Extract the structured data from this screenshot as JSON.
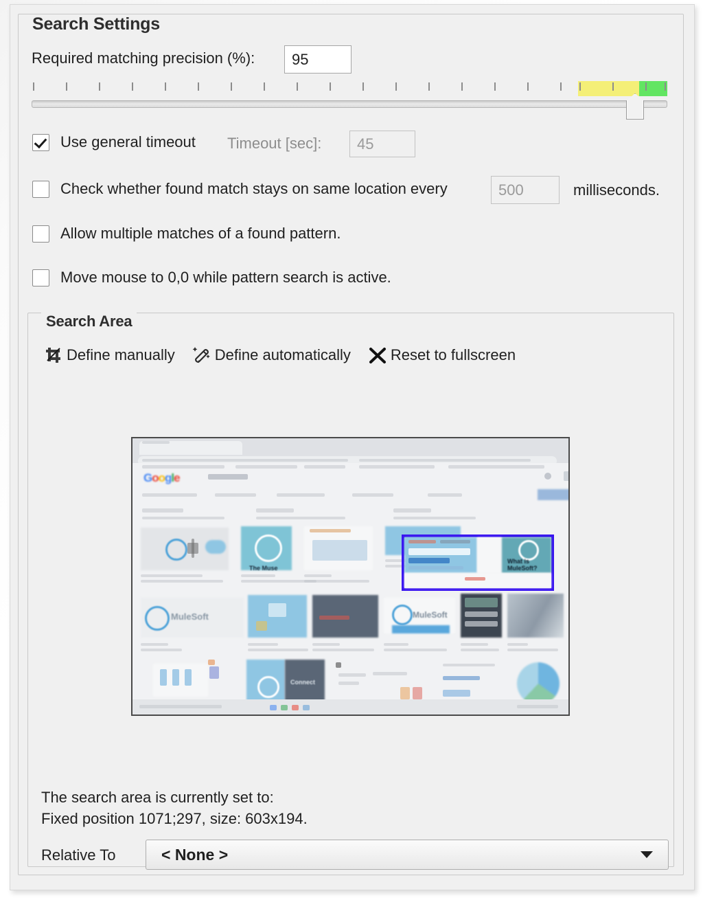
{
  "settings_group": {
    "title": "Search Settings",
    "precision": {
      "label": "Required matching precision (%):",
      "value": "95"
    },
    "slider": {
      "tick_count": 20,
      "thumb_percent": 95,
      "yellow_band": {
        "start_percent": 86,
        "end_percent": 96,
        "color": "#f4ef77"
      },
      "green_band": {
        "start_percent": 96,
        "end_percent": 100,
        "color": "#62e562"
      }
    },
    "checkboxes": [
      {
        "name": "use-general-timeout",
        "label": "Use general timeout",
        "checked": true
      },
      {
        "name": "check-same-location",
        "label": "Check whether found match stays on same location every",
        "checked": false
      },
      {
        "name": "allow-multiple-matches",
        "label": "Allow multiple matches of a found pattern.",
        "checked": false
      },
      {
        "name": "move-mouse-origin",
        "label": "Move mouse to 0,0 while pattern search is active.",
        "checked": false
      }
    ],
    "timeout": {
      "label": "Timeout [sec]:",
      "value": "45",
      "disabled": true
    },
    "interval": {
      "value": "500",
      "suffix": "milliseconds.",
      "disabled": true
    }
  },
  "search_area": {
    "title": "Search Area",
    "toolbar": [
      {
        "icon": "crop-tool-icon",
        "label": "Define manually"
      },
      {
        "icon": "magic-wand-icon",
        "label": "Define automatically"
      },
      {
        "icon": "close-x-icon",
        "label": "Reset to fullscreen"
      }
    ],
    "preview": {
      "logo_letters": [
        "G",
        "o",
        "o",
        "g",
        "l",
        "e"
      ],
      "search_query": "mule",
      "selection_caption_line1": "What is",
      "selection_caption_line2": "MuleSoft?",
      "brand_text": "MuleSoft"
    },
    "status": {
      "line1": "The search area is currently set to:",
      "line2": "Fixed position 1071;297, size: 603x194."
    },
    "relative_to": {
      "label": "Relative To",
      "value": "< None >"
    }
  }
}
